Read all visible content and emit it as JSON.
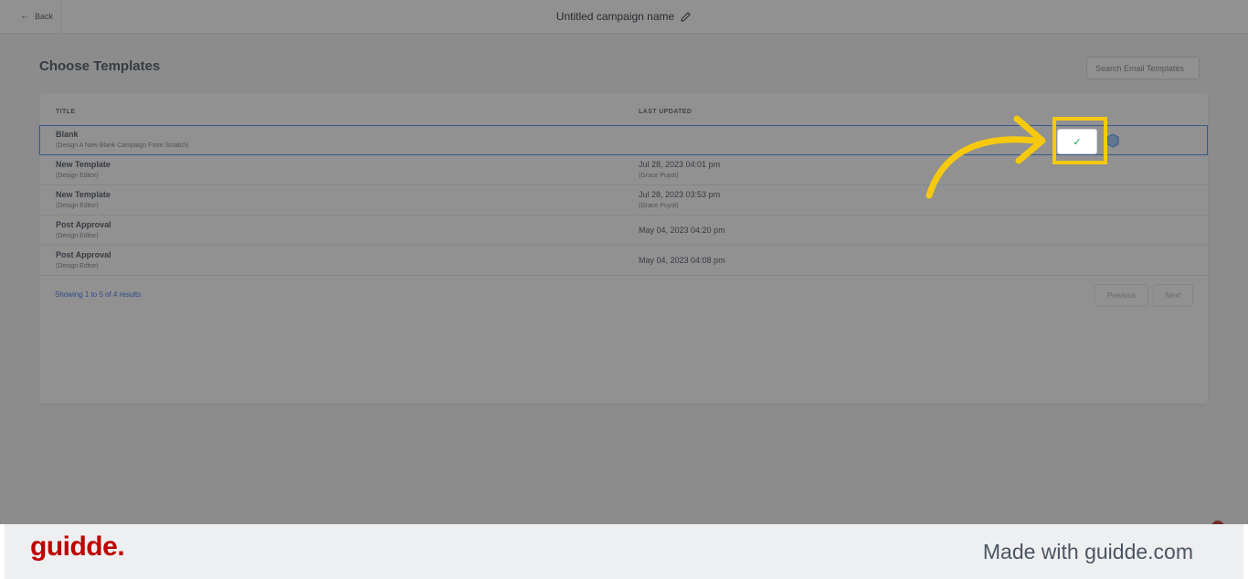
{
  "topbar": {
    "back_label": "Back",
    "campaign_name": "Untitled campaign name"
  },
  "page": {
    "heading": "Choose Templates",
    "search_placeholder": "Search Email Templates"
  },
  "table": {
    "headers": {
      "title": "TITLE",
      "last_updated": "LAST UPDATED"
    },
    "rows": [
      {
        "title": "Blank",
        "subtitle": "(Design A New Blank Campaign From Scratch)",
        "date": "",
        "by": ""
      },
      {
        "title": "New Template",
        "subtitle": "(Design Editor)",
        "date": "Jul 28, 2023 04:01 pm",
        "by": "(Grace Puyot)"
      },
      {
        "title": "New Template",
        "subtitle": "(Design Editor)",
        "date": "Jul 28, 2023 03:53 pm",
        "by": "(Grace Puyot)"
      },
      {
        "title": "Post Approval",
        "subtitle": "(Design Editor)",
        "date": "May 04, 2023 04:20 pm",
        "by": ""
      },
      {
        "title": "Post Approval",
        "subtitle": "(Design Editor)",
        "date": "May 04, 2023 04:08 pm",
        "by": ""
      }
    ]
  },
  "pagination": {
    "summary": "Showing 1 to 5 of 4 results",
    "previous": "Previous",
    "next": "Next"
  },
  "select_icon": "check-icon",
  "footer": {
    "logo": "guidde.",
    "made_with": "Made with guidde.com"
  },
  "colors": {
    "highlight": "#f6c90e",
    "accent": "#2563eb",
    "check": "#16a34a",
    "brand": "#c00000"
  }
}
